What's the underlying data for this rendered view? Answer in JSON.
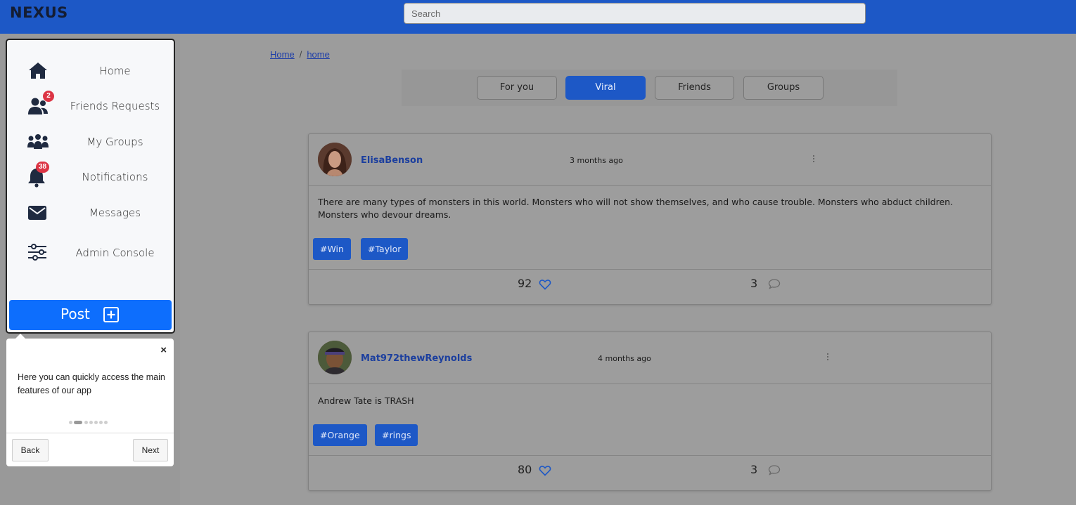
{
  "app": {
    "logo": "NEXUS"
  },
  "search": {
    "placeholder": "Search"
  },
  "sidebar": {
    "items": [
      {
        "label": "Home",
        "icon": "home-icon"
      },
      {
        "label": "Friends Requests",
        "icon": "users-icon",
        "badge": "2"
      },
      {
        "label": "My Groups",
        "icon": "groups-icon"
      },
      {
        "label": "Notifications",
        "icon": "bell-icon",
        "badge": "38"
      },
      {
        "label": "Messages",
        "icon": "envelope-icon"
      },
      {
        "label": "Admin Console",
        "icon": "sliders-icon"
      }
    ],
    "post_label": "Post"
  },
  "tour": {
    "close": "×",
    "text": "Here you can quickly access the main features of our app",
    "back": "Back",
    "next": "Next",
    "step": 2,
    "total_steps": 7
  },
  "breadcrumb": {
    "root": "Home",
    "separator": "/",
    "current": "home"
  },
  "tabs": [
    {
      "label": "For you",
      "active": false
    },
    {
      "label": "Viral",
      "active": true
    },
    {
      "label": "Friends",
      "active": false
    },
    {
      "label": "Groups",
      "active": false
    }
  ],
  "posts": [
    {
      "username": "ElisaBenson",
      "time": "3 months ago",
      "text": "There are many types of monsters in this world. Monsters who will not show themselves, and who cause trouble. Monsters who abduct children. Monsters who devour dreams.",
      "tags": [
        "#Win",
        "#Taylor"
      ],
      "likes": "92",
      "comments": "3"
    },
    {
      "username": "Mat972thewReynolds",
      "time": "4 months ago",
      "text": "Andrew Tate is TRASH",
      "tags": [
        "#Orange",
        "#rings"
      ],
      "likes": "80",
      "comments": "3"
    }
  ],
  "colors": {
    "topbar": "#1d58c6",
    "accent": "#0d6efd",
    "badge": "#dc3545"
  }
}
